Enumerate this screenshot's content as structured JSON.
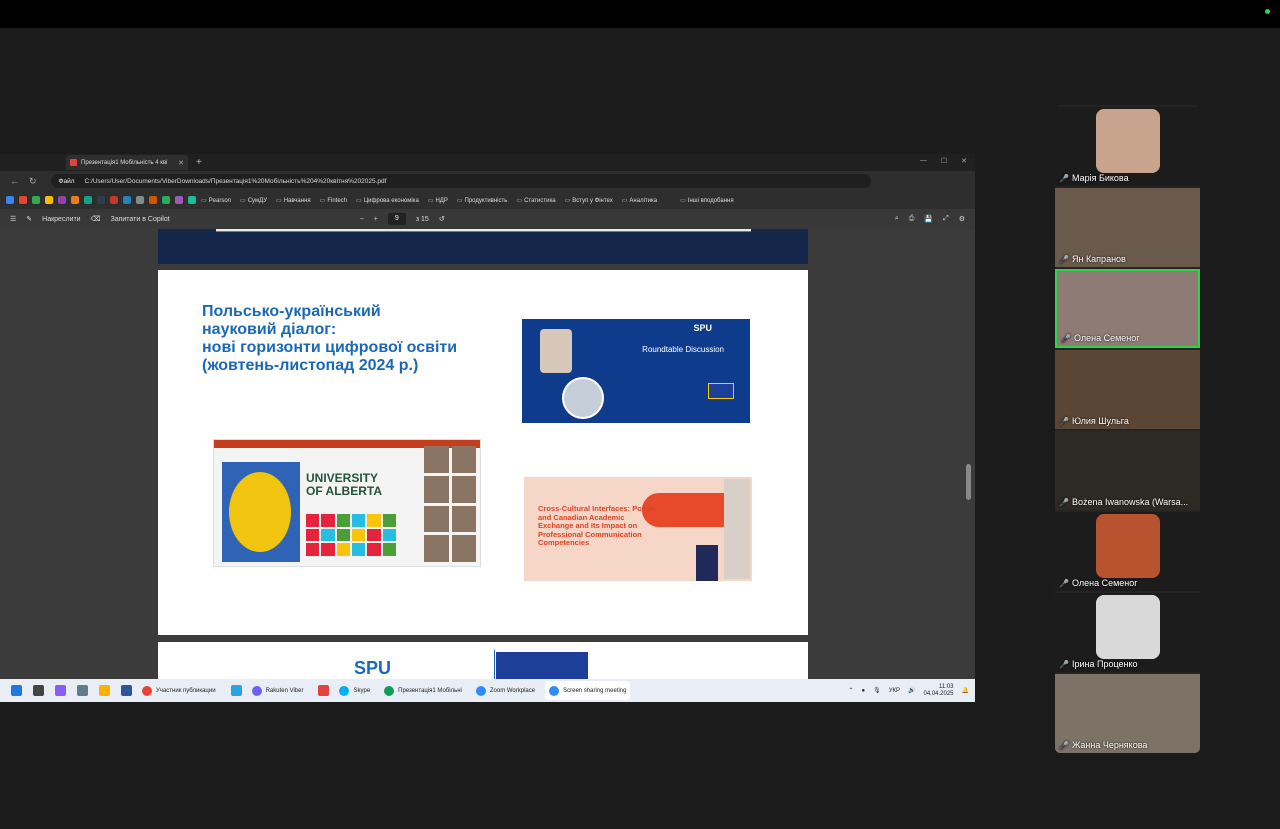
{
  "browser": {
    "tab_title": "Презентація1 Мобільність 4 кві",
    "address_label": "Файл",
    "url": "C:/Users/User/Documents/ViberDownloads/Презентація1%20Мобільність%204%20квітня%202025.pdf",
    "bookmarks": [
      "Pearson",
      "СумДУ",
      "Навчання",
      "Fintech",
      "Цифрова економіка",
      "НДР",
      "Продуктивність",
      "Статистика",
      "Вступ у Фінтех",
      "Аналітика"
    ],
    "other_bookmarks": "Інші вподобання"
  },
  "pdf_toolbar": {
    "draw_label": "Накреслити",
    "copilot_label": "Запитати в Copilot",
    "page_current": "9",
    "page_total": "з 15"
  },
  "slide": {
    "title_line1": "Польсько-український",
    "title_line2": "науковий діалог:",
    "title_line3": "нові горизонти цифрової освіти",
    "title_line4": "(жовтень-листопад 2024 р.)",
    "roundtable_title": "Roundtable Discussion",
    "spu_label": "SPU",
    "ua_line1": "UNIVERSITY",
    "ua_line2": "OF ALBERTA",
    "cc_title": "Cross-Cultural Interfaces: Polish and Canadian Academic Exchange and Its Impact on Professional Communication Competencies"
  },
  "taskbar": {
    "apps": [
      "Участник публикации",
      "Rakuten Viber",
      "Skype",
      "Презентація1 Мобільні",
      "Zoom Workplace",
      "Screen sharing meeting"
    ],
    "lang": "УКР",
    "time": "11:03",
    "date": "04.04.2025"
  },
  "participants": [
    {
      "name": "Марія Бикова",
      "type": "avatar",
      "color": "#c9a48c",
      "speaking": false
    },
    {
      "name": "Ян Капранов",
      "type": "video",
      "color": "#6a5a4c",
      "speaking": false
    },
    {
      "name": "Олена Семеног",
      "type": "video",
      "color": "#8f7b76",
      "speaking": true
    },
    {
      "name": "Юлия Шульга",
      "type": "video",
      "color": "#5b4636",
      "speaking": false
    },
    {
      "name": "Bożena Iwanowska (Warsa...",
      "type": "video",
      "color": "#2d2a24",
      "speaking": false
    },
    {
      "name": "Олена Семеног",
      "type": "avatar",
      "color": "#b8532f",
      "speaking": false
    },
    {
      "name": "Ірина Проценко",
      "type": "avatar",
      "color": "#d9d9d9",
      "speaking": false
    },
    {
      "name": "Жанна Чернякова",
      "type": "video",
      "color": "#7d7266",
      "speaking": false
    }
  ]
}
